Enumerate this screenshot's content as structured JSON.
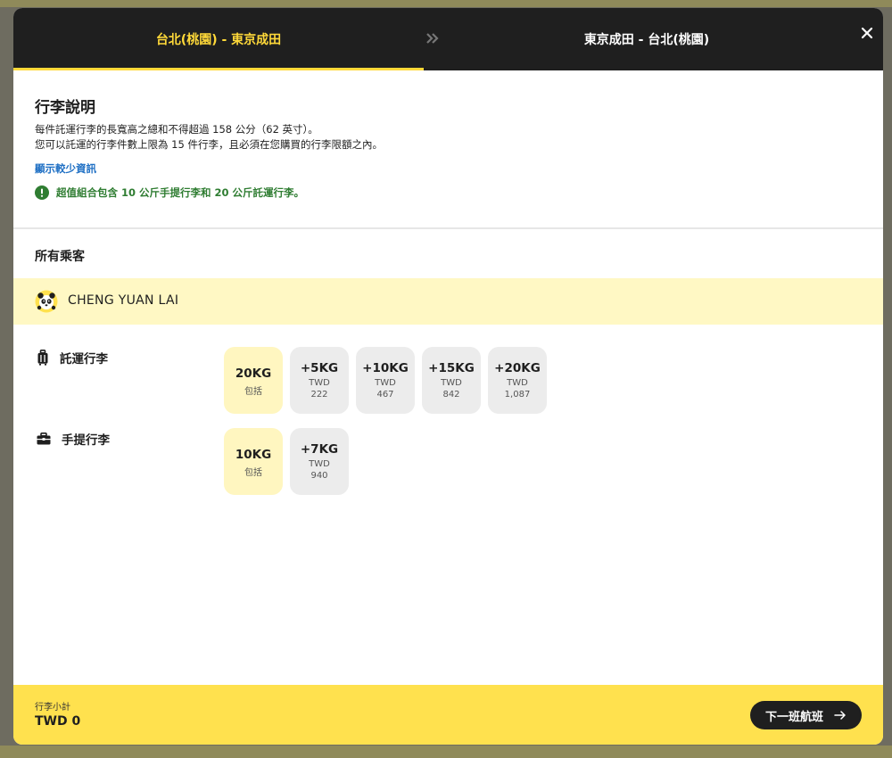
{
  "tabs": {
    "outbound": "台北(桃園) - 東京成田",
    "return": "東京成田 - 台北(桃園)"
  },
  "info": {
    "title": "行李說明",
    "line1": "每件託運行李的長寬高之總和不得超過 158 公分（62 英寸）。",
    "line2": "您可以託運的行李件數上限為 15 件行李，且必須在您購買的行李限額之內。",
    "toggle_link": "顯示較少資訊",
    "bundle_note": "超值組合包含 10 公斤手提行李和 20 公斤託運行李。"
  },
  "passengers": {
    "title": "所有乘客",
    "name": "CHENG YUAN LAI"
  },
  "checked": {
    "label": "託運行李",
    "options": [
      {
        "weight": "20KG",
        "sub": "包括",
        "price": ""
      },
      {
        "weight": "+5KG",
        "sub": "TWD",
        "price": "222"
      },
      {
        "weight": "+10KG",
        "sub": "TWD",
        "price": "467"
      },
      {
        "weight": "+15KG",
        "sub": "TWD",
        "price": "842"
      },
      {
        "weight": "+20KG",
        "sub": "TWD",
        "price": "1,087"
      }
    ]
  },
  "cabin": {
    "label": "手提行李",
    "options": [
      {
        "weight": "10KG",
        "sub": "包括",
        "price": ""
      },
      {
        "weight": "+7KG",
        "sub": "TWD",
        "price": "940"
      }
    ]
  },
  "footer": {
    "subtotal_label": "行李小計",
    "subtotal_value": "TWD 0",
    "next_label": "下一班航班"
  },
  "colors": {
    "accent_yellow": "#ffd939",
    "footer_yellow": "#ffe14e",
    "selected_bg": "#fff6c0",
    "link_blue": "#1e6fc4",
    "success_green": "#2f7d32"
  }
}
